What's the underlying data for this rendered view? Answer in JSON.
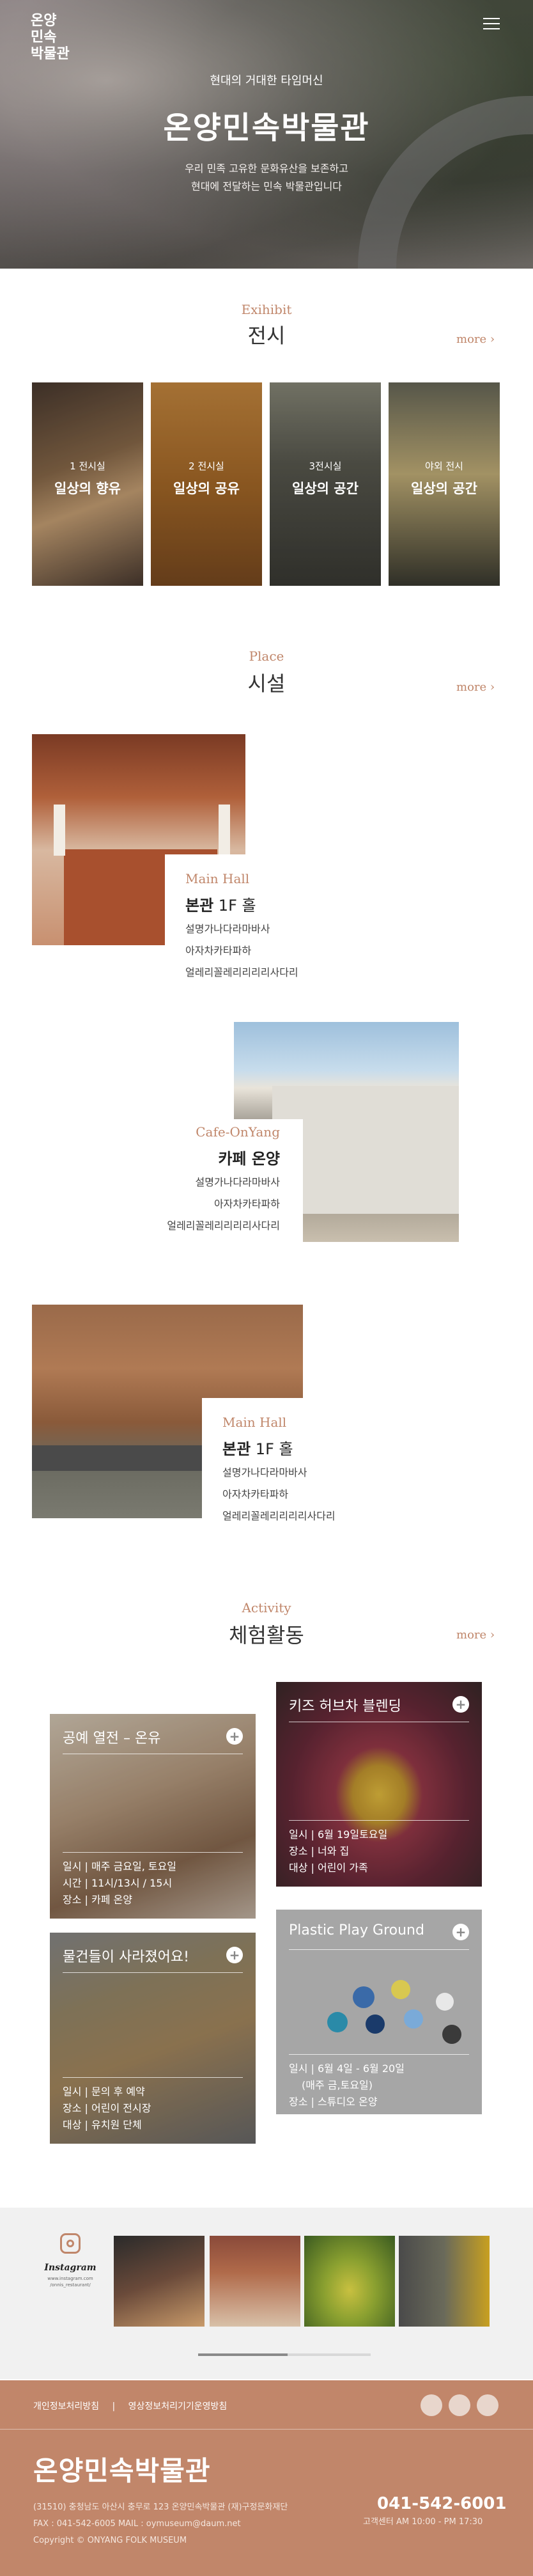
{
  "brand": {
    "logo_lines": [
      "온양",
      "민속",
      "박물관"
    ]
  },
  "hero": {
    "subtitle": "현대의 거대한 타임머신",
    "title": "온양민속박물관",
    "desc_line1": "우리 민족 고유한 문화유산을 보존하고",
    "desc_line2": "현대에 전달하는 민속 박물관입니다"
  },
  "exhibit": {
    "en": "Exihibit",
    "ko": "전시",
    "more": "more",
    "cards": [
      {
        "num": "1 전시실",
        "name": "일상의 향유"
      },
      {
        "num": "2 전시실",
        "name": "일상의 공유"
      },
      {
        "num": "3전시실",
        "name": "일상의 공간"
      },
      {
        "num": "야외 전시",
        "name": "일상의 공간"
      }
    ]
  },
  "place": {
    "en": "Place",
    "ko": "시설",
    "more": "more",
    "items": [
      {
        "en": "Main Hall",
        "ko_bold": "본관",
        "ko_rest": " 1F 홀",
        "lines": [
          "설명가나다라마바사",
          "아자차카타파하",
          "얼레리꼴레리리리리사다리"
        ]
      },
      {
        "en": "Cafe-OnYang",
        "ko_bold": "카페 온양",
        "ko_rest": "",
        "lines": [
          "설명가나다라마바사",
          "아자차카타파하",
          "얼레리꼴레리리리리사다리"
        ]
      },
      {
        "en": "Main Hall",
        "ko_bold": "본관",
        "ko_rest": " 1F 홀",
        "lines": [
          "설명가나다라마바사",
          "아자차카타파하",
          "얼레리꼴레리리리리사다리"
        ]
      }
    ]
  },
  "activity": {
    "en": "Activity",
    "ko": "체험활동",
    "more": "more",
    "items": [
      {
        "title": "공예 열전 – 온유",
        "lines": [
          "일시 | 매주 금요일, 토요일",
          "시간 | 11시/13시 / 15시",
          "장소 | 카페 온양"
        ]
      },
      {
        "title": "키즈 허브차 블렌딩",
        "lines": [
          "일시 | 6월 19일토요일",
          "장소 | 너와 집",
          "대상 | 어린이 가족"
        ]
      },
      {
        "title": "물건들이 사라졌어요!",
        "lines": [
          "일시 | 문의 후 예약",
          "장소 | 어린이 전시장",
          "대상 | 유치원 단체"
        ]
      },
      {
        "title": "Plastic Play Ground",
        "lines": [
          "일시 | 6월 4일 - 6월 20일",
          "(매주 금,토요일)",
          "장소 | 스튜디오 온양"
        ]
      }
    ]
  },
  "instagram": {
    "name": "Instagram",
    "url_line1": "www.instagram.com",
    "url_line2": "/onnis_restaurant/"
  },
  "footer": {
    "link1": "개인정보처리방침",
    "link2": "영상정보처리기기운영방침",
    "logo": "온양민속박물관",
    "addr_line1": "(31510) 충청남도 아산시 충무로 123 온양민속박물관 (재)구정문화재단",
    "addr_line2": "FAX : 041-542-6005     MAIL : oymuseum@daum.net",
    "copyright": "Copyright © ONYANG FOLK MUSEUM",
    "phone": "041-542-6001",
    "hours": "고객센터 AM 10:00 - PM 17:30"
  }
}
